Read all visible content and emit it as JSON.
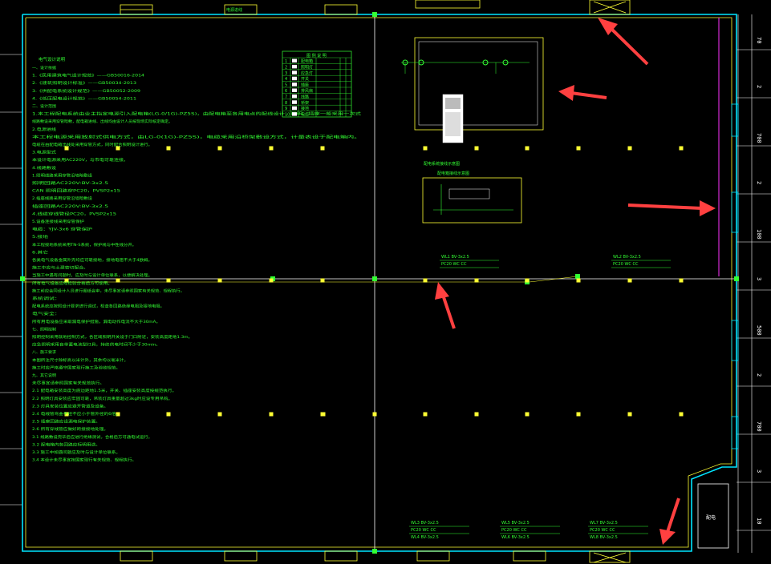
{
  "drawing": {
    "border_color": "#ffff33",
    "wall_color": "#00e5ff",
    "text_color": "#33ff33",
    "magenta_line": "#ff33ff",
    "arrow_color": "#ff4040"
  },
  "axis_labels": {
    "right": [
      "70",
      "2",
      "700",
      "2",
      "100",
      "3",
      "500",
      "2",
      "700",
      "3",
      "10"
    ]
  },
  "legend_title": "图 例 说 明",
  "room_label": "配电",
  "notes": {
    "title": "电气设计说明",
    "lines": [
      "一、设计依据",
      "1.《民用建筑电气设计规范》——GB50016-2014",
      "2.《建筑照明设计标准》——GB50034-2013",
      "3.《供配电系统设计规范》——GB50052-2009",
      "4.《低压配电设计规范》——GB50054-2011",
      "二、设计范围",
      "1.本工程配电系统由业主指定电源引入配电箱(LG-0/1G)-PZ5S)，由配电箱至各用电点的配线设计，照明、插座一般采用一次式",
      "线路敷设采用穿管暗敷，配电箱进线、出线均由设计人员按现场实际核定确定。",
      "2.电源进线",
      "  本工程电源采用放射式供电方式，由LG-0(1G)-PZ5S)，电缆采用沿桥架敷设方式，计量表设于配电箱内。",
      "  电缆在由配电箱出线处采用穿管方式，同时配合照明设计进行。",
      "3.电源型式",
      "  本设计电源采用AC220V，与市电可靠连接。",
      "4.线路敷设",
      "1.照明线路采用穿管沿墙暗敷设",
      "照明回路AC220V:BV-3x2.5",
      "CAN 照明回路穿PC20，PVSP2x15",
      "2.插座线路采用穿管沿墙暗敷设",
      "插座回路AC220V:BV-3x2.5",
      "4.线缆穿线管径PC20，PVSP2x15",
      "5.设备连接线采用穿管保护",
      "电缆：YJV-3x6 穿管保护",
      "5.接地",
      "本工程接地系统采用TN-S系统，保护线与中性线分开。",
      "6.其它",
      "  各类电气设备金属外壳均应可靠接地，接地电阻不大于4欧姆。",
      "  施工中应与土建密切配合。",
      "  当施工中遇有问题时，应及时与设计单位联系，以便解决处理。",
      "  所有电气设备应经检验合格后方可使用。",
      "  施工前应会同设计人员进行图纸会审，未尽事宜请参照国家有关规范、规程执行。",
      "  系统调试：",
      "  配电系统应按照设计要求进行调试，检查各回路绝缘电阻及接地电阻。",
      "  电气安全：",
      "  所有用电设备应采取漏电保护措施，漏电动作电流不大于30mA。",
      "七、照明控制",
      "  照明控制采用就地控制方式，各区域照明开关设于门口附近，安装高度距地1.3m。",
      "  应急照明采用自带蓄电池型灯具，持续供电时间不少于30min。",
      "八、施工要求",
      "  本图所注尺寸除标高以米计外，其余均以毫米计。",
      "  施工时应严格遵守国家现行施工及验收规范。",
      "九、其它说明",
      "  未尽事宜请参照国家有关规范执行。",
      "2.1 配电箱安装高度为底边距地1.5米，开关、插座安装高度按规范执行。",
      "2.2 照明灯具安装应牢固可靠，吊装灯具重量超过3kg时应设专用吊钩。",
      "2.3 灯具安装位置应避开管道及设备。",
      "2.4 电线管弯曲半径不应小于管外径的6倍。",
      "2.5 插座回路应设漏电保护装置。",
      "2.6 所有穿线管应做好跨接接地处理。",
      "3.1 线路敷设完毕后应进行绝缘测试，合格后方可通电试运行。",
      "3.2 配电箱内各回路应标明用途。",
      "3.3 施工中如遇问题应及时与设计单位联系。",
      "3.4 本设计未尽事宜按国家现行有关规范、规程执行。"
    ]
  },
  "legend_rows": [
    {
      "no": "1",
      "name": "配电箱"
    },
    {
      "no": "2",
      "name": "照明灯"
    },
    {
      "no": "3",
      "name": "应急灯"
    },
    {
      "no": "4",
      "name": "开关"
    },
    {
      "no": "5",
      "name": "插座"
    },
    {
      "no": "6",
      "name": "排风扇"
    },
    {
      "no": "7",
      "name": "线路"
    },
    {
      "no": "8",
      "name": "桥架"
    },
    {
      "no": "9",
      "name": "接地"
    },
    {
      "no": "10",
      "name": "电缆"
    }
  ],
  "schematic_label": "配电系统接线示意图",
  "small_schematic_label": "配电箱接线示意图",
  "circuit_labels": {
    "mid_left": [
      "WL1 BV-3x2.5",
      "PC20 WC CC"
    ],
    "mid_right": [
      "WL2 BV-3x2.5",
      "PC20 WC CC"
    ],
    "bottom_1": [
      "WL3 BV-3x2.5",
      "PC20 WC CC",
      "WL4 BV-3x2.5"
    ],
    "bottom_2": [
      "WL5 BV-3x2.5",
      "PC20 WC CC",
      "WL6 BV-3x2.5"
    ],
    "bottom_3": [
      "WL7 BV-3x2.5",
      "PC20 WC CC",
      "WL8 BV-3x2.5"
    ],
    "top_edge": "电源进线"
  }
}
